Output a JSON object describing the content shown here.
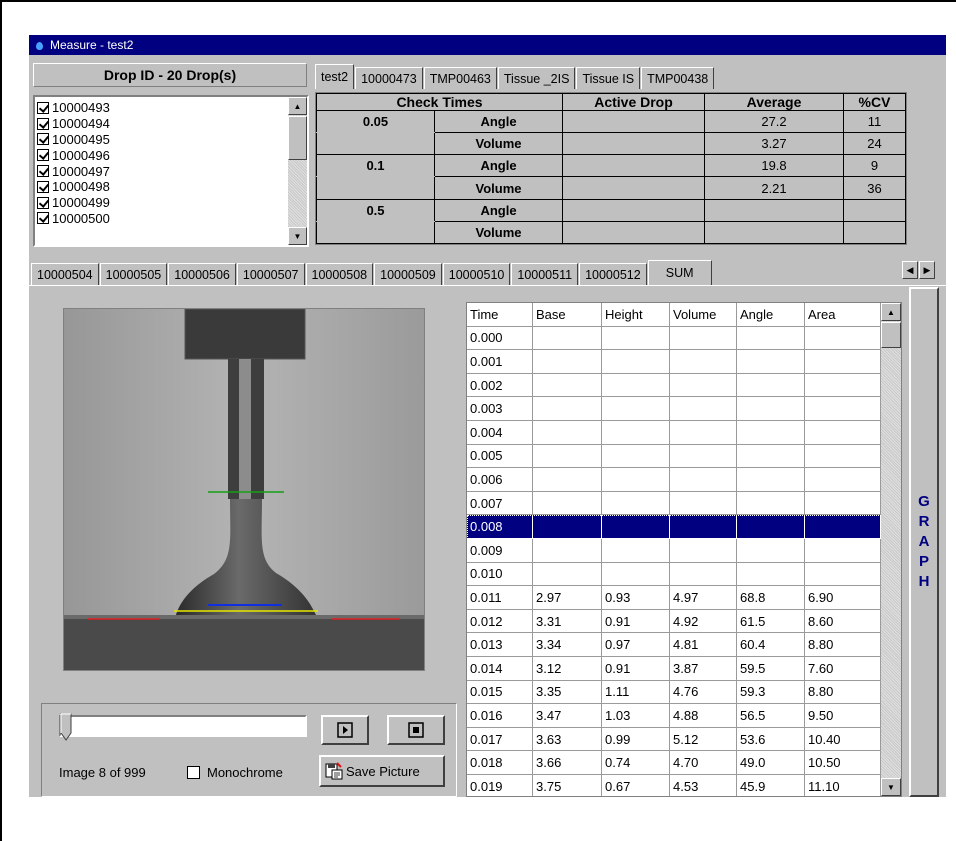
{
  "window": {
    "title": "Measure - test2"
  },
  "drop_panel": {
    "header": "Drop ID - 20 Drop(s)",
    "items": [
      {
        "label": "10000493",
        "checked": true
      },
      {
        "label": "10000494",
        "checked": true
      },
      {
        "label": "10000495",
        "checked": true
      },
      {
        "label": "10000496",
        "checked": true
      },
      {
        "label": "10000497",
        "checked": true
      },
      {
        "label": "10000498",
        "checked": true
      },
      {
        "label": "10000499",
        "checked": true
      },
      {
        "label": "10000500",
        "checked": true
      }
    ]
  },
  "top_tabs": [
    "test2",
    "10000473",
    "TMP00463",
    "Tissue _2IS",
    "Tissue IS",
    "TMP00438"
  ],
  "check_table": {
    "headers": [
      "Check Times",
      "Active Drop",
      "Average",
      "%CV"
    ],
    "rows": [
      {
        "time": "0.05",
        "metric": "Angle",
        "active": "",
        "average": "27.2",
        "cv": "11"
      },
      {
        "time": "",
        "metric": "Volume",
        "active": "",
        "average": "3.27",
        "cv": "24"
      },
      {
        "time": "0.1",
        "metric": "Angle",
        "active": "",
        "average": "19.8",
        "cv": "9"
      },
      {
        "time": "",
        "metric": "Volume",
        "active": "",
        "average": "2.21",
        "cv": "36"
      },
      {
        "time": "0.5",
        "metric": "Angle",
        "active": "",
        "average": "",
        "cv": ""
      },
      {
        "time": "",
        "metric": "Volume",
        "active": "",
        "average": "",
        "cv": ""
      }
    ]
  },
  "drop_tabs": [
    "10000504",
    "10000505",
    "10000506",
    "10000507",
    "10000508",
    "10000509",
    "10000510",
    "10000511",
    "10000512",
    "SUM"
  ],
  "scroll_arrows": {
    "left": "◀",
    "right": "▶"
  },
  "image_controls": {
    "image_counter": "Image 8 of 999",
    "monochrome_label": "Monochrome",
    "save_label": "Save Picture",
    "slider_position": 0.0
  },
  "grid": {
    "headers": [
      "Time",
      "Base",
      "Height",
      "Volume",
      "Angle",
      "Area"
    ],
    "selected_index": 8,
    "rows": [
      [
        "0.000",
        "",
        "",
        "",
        "",
        ""
      ],
      [
        "0.001",
        "",
        "",
        "",
        "",
        ""
      ],
      [
        "0.002",
        "",
        "",
        "",
        "",
        ""
      ],
      [
        "0.003",
        "",
        "",
        "",
        "",
        ""
      ],
      [
        "0.004",
        "",
        "",
        "",
        "",
        ""
      ],
      [
        "0.005",
        "",
        "",
        "",
        "",
        ""
      ],
      [
        "0.006",
        "",
        "",
        "",
        "",
        ""
      ],
      [
        "0.007",
        "",
        "",
        "",
        "",
        ""
      ],
      [
        "0.008",
        "",
        "",
        "",
        "",
        ""
      ],
      [
        "0.009",
        "",
        "",
        "",
        "",
        ""
      ],
      [
        "0.010",
        "",
        "",
        "",
        "",
        ""
      ],
      [
        "0.011",
        "2.97",
        "0.93",
        "4.97",
        "68.8",
        "6.90"
      ],
      [
        "0.012",
        "3.31",
        "0.91",
        "4.92",
        "61.5",
        "8.60"
      ],
      [
        "0.013",
        "3.34",
        "0.97",
        "4.81",
        "60.4",
        "8.80"
      ],
      [
        "0.014",
        "3.12",
        "0.91",
        "3.87",
        "59.5",
        "7.60"
      ],
      [
        "0.015",
        "3.35",
        "1.11",
        "4.76",
        "59.3",
        "8.80"
      ],
      [
        "0.016",
        "3.47",
        "1.03",
        "4.88",
        "56.5",
        "9.50"
      ],
      [
        "0.017",
        "3.63",
        "0.99",
        "5.12",
        "53.6",
        "10.40"
      ],
      [
        "0.018",
        "3.66",
        "0.74",
        "4.70",
        "49.0",
        "10.50"
      ],
      [
        "0.019",
        "3.75",
        "0.67",
        "4.53",
        "45.9",
        "11.10"
      ]
    ]
  },
  "graph_button": {
    "letters": [
      "G",
      "R",
      "A",
      "P",
      "H"
    ]
  },
  "colors": {
    "titlebar": "#000080",
    "selection": "#000080",
    "graph_text": "#000080",
    "face": "#c0c0c0"
  }
}
